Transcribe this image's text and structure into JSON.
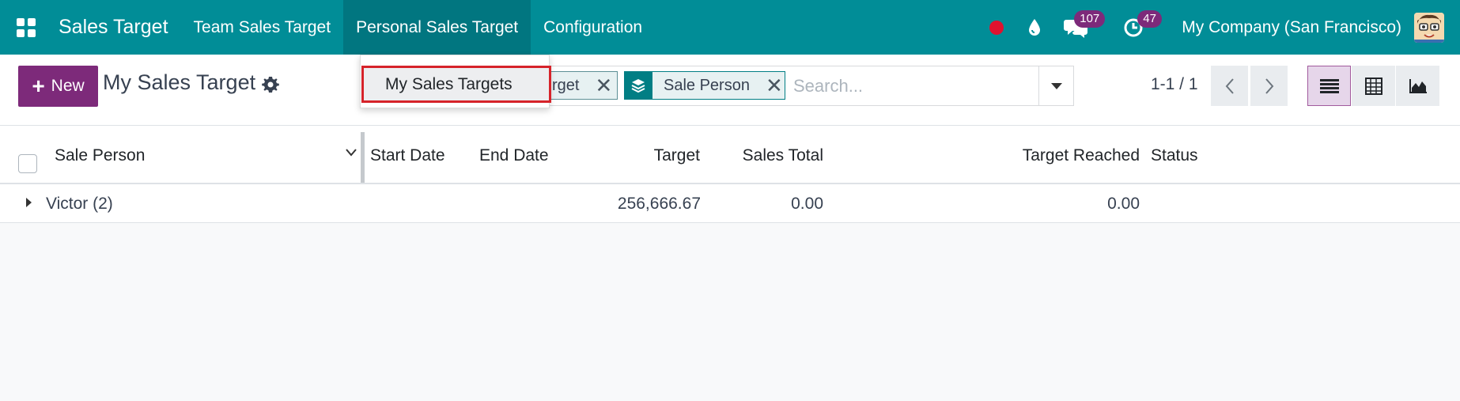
{
  "navbar": {
    "app_title": "Sales Target",
    "menu": [
      "Team Sales Target",
      "Personal Sales Target",
      "Configuration"
    ],
    "messages_count": "107",
    "activities_count": "47",
    "company": "My Company (San Francisco)",
    "color": "#018d97"
  },
  "dropdown": {
    "items": [
      "My Sales Targets"
    ]
  },
  "control": {
    "new_label": "New",
    "title": "My Sales Target",
    "facets": [
      {
        "value": "rget"
      },
      {
        "value": "Sale Person"
      }
    ],
    "search_placeholder": "Search...",
    "pager": "1-1 / 1"
  },
  "list": {
    "columns": [
      "Sale Person",
      "Start Date",
      "End Date",
      "Target",
      "Sales Total",
      "Target Reached",
      "Status"
    ],
    "groups": [
      {
        "name": "Victor (2)",
        "target": "256,666.67",
        "sales_total": "0.00",
        "target_reached": "0.00"
      }
    ]
  },
  "colors": {
    "accent": "#7d2a7a",
    "highlight": "#d6232a"
  }
}
